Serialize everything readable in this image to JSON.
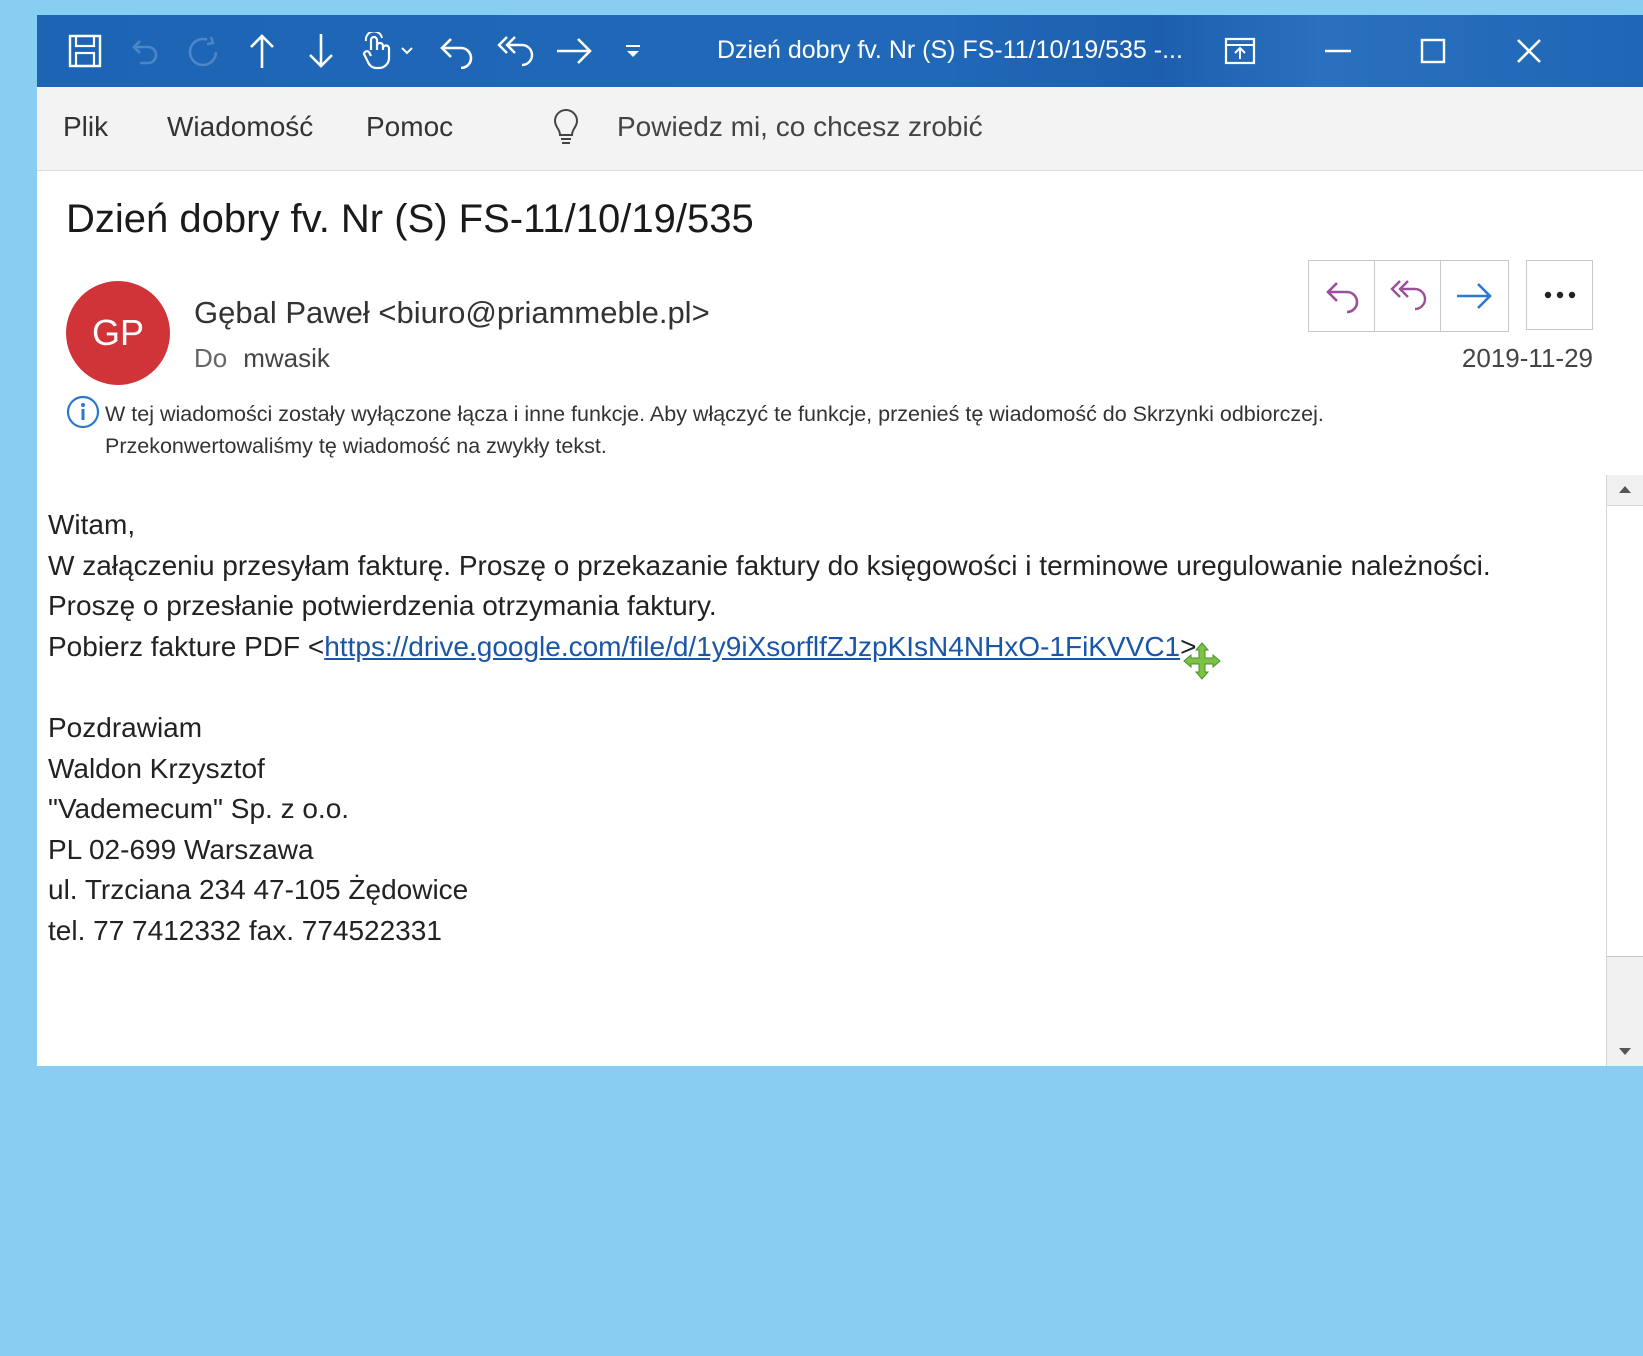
{
  "window": {
    "title": "Dzień dobry fv. Nr (S) FS-11/10/19/535 -..."
  },
  "menu": {
    "items": [
      "Plik",
      "Wiadomość",
      "Pomoc"
    ],
    "tell_me": "Powiedz mi, co chcesz zrobić"
  },
  "message": {
    "subject": "Dzień dobry fv. Nr (S) FS-11/10/19/535",
    "avatar_initials": "GP",
    "avatar_color": "#d13438",
    "sender": "Gębal Paweł <biuro@priammeble.pl>",
    "to_label": "Do",
    "to_value": "mwasik",
    "date": "2019-11-29",
    "info_line1": "W tej wiadomości zostały wyłączone łącza i inne funkcje. Aby włączyć te funkcje, przenieś tę wiadomość do Skrzynki odbiorczej.",
    "info_line2": "Przekonwertowaliśmy tę wiadomość na zwykły tekst."
  },
  "body": {
    "greeting": "Witam,",
    "line1": "W załączeniu przesyłam fakturę. Proszę o przekazanie faktury do księgowości i terminowe uregulowanie należności.",
    "line2": "Proszę o przesłanie potwierdzenia otrzymania faktury.",
    "link_prefix": "Pobierz fakture PDF <",
    "link_text": "https://drive.google.com/file/d/1y9iXsorflfZJzpKIsN4NHxO-1FiKVVC1",
    "link_suffix": ">",
    "signature": [
      "Pozdrawiam",
      "Waldon Krzysztof",
      "\"Vademecum\" Sp. z o.o.",
      "PL 02-699 Warszawa",
      "ul. Trzciana 234 47-105 Żędowice",
      "tel. 77 7412332 fax. 774522331"
    ]
  },
  "icons": {
    "qat": [
      "save-icon",
      "undo-icon",
      "redo-icon",
      "up-arrow-icon",
      "down-arrow-icon",
      "touch-mode-icon",
      "reply-icon",
      "reply-all-icon",
      "forward-icon",
      "customize-qat-icon"
    ],
    "window_controls": [
      "ribbon-display-icon",
      "minimize-icon",
      "maximize-icon",
      "close-icon"
    ],
    "actions": [
      "reply-icon",
      "reply-all-icon",
      "forward-icon",
      "more-icon"
    ]
  },
  "colors": {
    "titlebar": "#2069b9",
    "desktop": "#87cef2",
    "link": "#1a56a8",
    "reply_icon": "#9b4f9b",
    "forward_icon": "#2b78d0"
  }
}
